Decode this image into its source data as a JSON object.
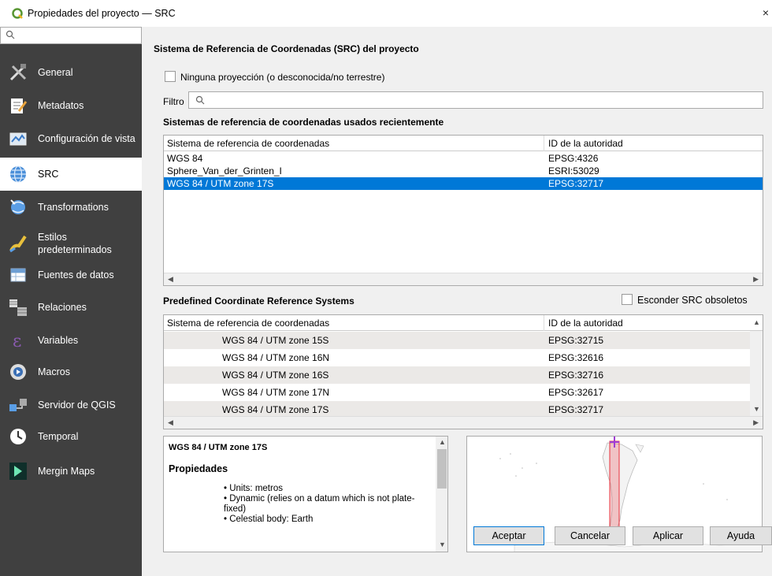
{
  "window": {
    "title": "Propiedades del proyecto — SRC",
    "close": "×"
  },
  "sidebar": {
    "items": [
      {
        "label": "General",
        "icon": "tools-icon"
      },
      {
        "label": "Metadatos",
        "icon": "edit-document-icon"
      },
      {
        "label": "Configuración de vista",
        "icon": "map-view-icon"
      },
      {
        "label": "SRC",
        "icon": "globe-icon"
      },
      {
        "label": "Transformations",
        "icon": "transform-globe-icon"
      },
      {
        "label": "Estilos predeterminados",
        "icon": "brush-icon"
      },
      {
        "label": "Fuentes de datos",
        "icon": "table-icon"
      },
      {
        "label": "Relaciones",
        "icon": "relations-icon"
      },
      {
        "label": "Variables",
        "icon": "epsilon-icon"
      },
      {
        "label": "Macros",
        "icon": "macro-gear-icon"
      },
      {
        "label": "Servidor de QGIS",
        "icon": "server-icon"
      },
      {
        "label": "Temporal",
        "icon": "clock-icon"
      },
      {
        "label": "Mergin Maps",
        "icon": "mergin-icon"
      }
    ]
  },
  "crs": {
    "header": "Sistema de Referencia de Coordenadas (SRC) del proyecto",
    "no_projection": "Ninguna proyección (o desconocida/no terrestre)",
    "filter_label": "Filtro",
    "recent_header": "Sistemas de referencia de coordenadas usados recientemente",
    "col_crs": "Sistema de referencia de coordenadas",
    "col_id": "ID de la autoridad",
    "recent_rows": [
      {
        "name": "WGS 84",
        "id": "EPSG:4326"
      },
      {
        "name": "Sphere_Van_der_Grinten_I",
        "id": "ESRI:53029"
      },
      {
        "name": "WGS 84 / UTM zone 17S",
        "id": "EPSG:32717"
      }
    ],
    "predefined_header": "Predefined Coordinate Reference Systems",
    "hide_deprecated": "Esconder SRC obsoletos",
    "predefined_rows": [
      {
        "name": "WGS 84 / UTM zone 15S",
        "id": "EPSG:32715"
      },
      {
        "name": "WGS 84 / UTM zone 16N",
        "id": "EPSG:32616"
      },
      {
        "name": "WGS 84 / UTM zone 16S",
        "id": "EPSG:32716"
      },
      {
        "name": "WGS 84 / UTM zone 17N",
        "id": "EPSG:32617"
      },
      {
        "name": "WGS 84 / UTM zone 17S",
        "id": "EPSG:32717"
      }
    ],
    "info": {
      "title": "WGS 84 / UTM zone 17S",
      "props_header": "Propiedades",
      "props": [
        "Units: metros",
        "Dynamic (relies on a datum which is not plate-fixed)",
        "Celestial body: Earth"
      ]
    }
  },
  "buttons": {
    "ok": "Aceptar",
    "cancel": "Cancelar",
    "apply": "Aplicar",
    "help": "Ayuda"
  },
  "colors": {
    "sidebar_bg": "#404040",
    "selection": "#0078d7",
    "extent": "#e8323c"
  }
}
